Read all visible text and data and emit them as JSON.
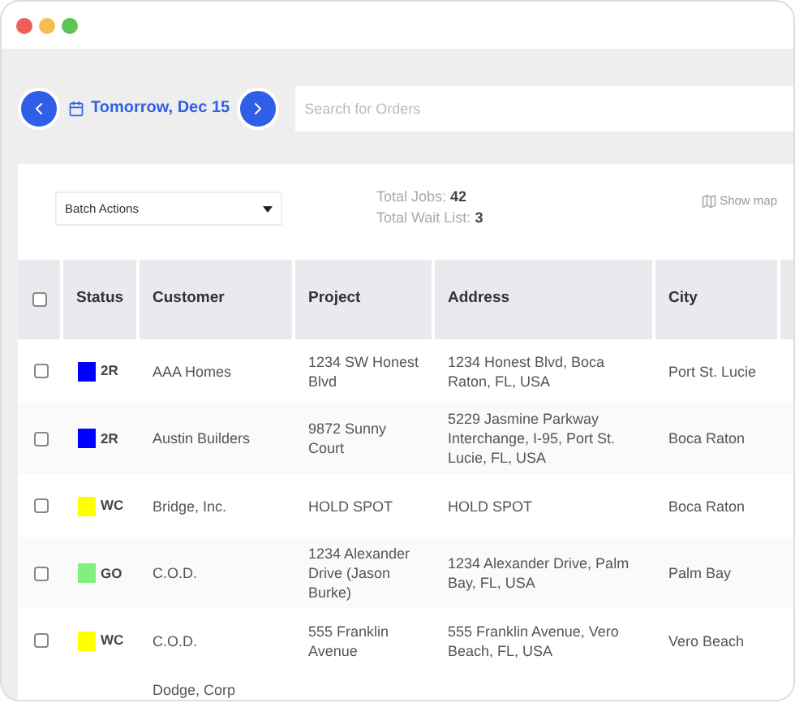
{
  "toolbar": {
    "date": "Tomorrow, Dec 15",
    "search": {
      "placeholder": "Search for Orders"
    }
  },
  "summary": {
    "batch_actions": "Batch Actions",
    "total_jobs_label": "Total Jobs:",
    "total_jobs": "42",
    "wait_list_label": "Total Wait List:",
    "wait_list": "3",
    "show_map": "Show map"
  },
  "table": {
    "select_all": {
      "checked": false
    },
    "columns": [
      "Status",
      "Customer",
      "Project",
      "Address",
      "City"
    ],
    "rows": [
      {
        "checked": false,
        "status": "2R",
        "color": "#0000ff",
        "customer": "AAA Homes",
        "project": "1234 SW Honest Blvd",
        "address": "1234 Honest Blvd, Boca Raton, FL, USA",
        "city": "Port St. Lucie"
      },
      {
        "checked": false,
        "status": "2R",
        "color": "#0000ff",
        "customer": "Austin Builders",
        "project": "9872 Sunny Court",
        "address": "5229 Jasmine Parkway Interchange, I-95, Port St. Lucie, FL, USA",
        "city": "Boca Raton"
      },
      {
        "checked": false,
        "status": "WC",
        "color": "#ffff00",
        "customer": "Bridge, Inc.",
        "project": "HOLD SPOT",
        "address": "HOLD SPOT",
        "city": "Boca Raton"
      },
      {
        "checked": false,
        "status": "GO",
        "color": "#80f080",
        "customer": "C.O.D.",
        "project": "1234 Alexander Drive (Jason Burke)",
        "address": "1234 Alexander Drive, Palm Bay, FL, USA",
        "city": "Palm Bay"
      },
      {
        "checked": false,
        "status": "WC",
        "color": "#ffff00",
        "customer": "C.O.D.",
        "project": "555 Franklin Avenue",
        "address": "555 Franklin Avenue, Vero Beach, FL, USA",
        "city": "Vero Beach"
      }
    ],
    "partial_row": {
      "customer": "Dodge, Corp"
    }
  }
}
